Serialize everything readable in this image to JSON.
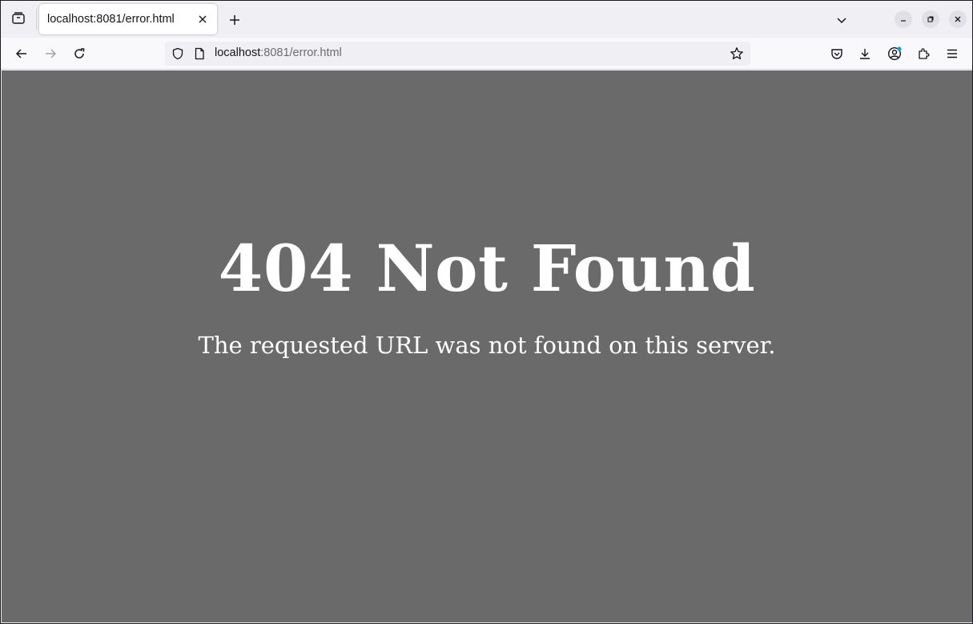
{
  "browser": {
    "tab": {
      "title": "localhost:8081/error.html"
    },
    "url": {
      "host": "localhost",
      "rest": ":8081/error.html"
    }
  },
  "icons": {
    "tab_list": "tab-list-icon",
    "tab_close": "close-icon",
    "new_tab": "plus-icon",
    "tabs_dropdown": "chevron-down-icon",
    "minimize": "minimize-icon",
    "restore": "restore-icon",
    "close_window": "close-icon",
    "back": "arrow-left-icon",
    "forward": "arrow-right-icon",
    "reload": "reload-icon",
    "tracking_protection": "shield-icon",
    "page_info": "page-icon",
    "bookmark": "star-icon",
    "pocket": "pocket-icon",
    "downloads": "download-icon",
    "account": "account-icon",
    "extensions": "puzzle-icon",
    "menu": "hamburger-menu-icon"
  },
  "colors": {
    "page_background": "#6a6a6a",
    "text": "#ffffff",
    "account_badge": "#0aa1e8"
  },
  "page": {
    "heading": "404 Not Found",
    "message": "The requested URL was not found on this server."
  }
}
